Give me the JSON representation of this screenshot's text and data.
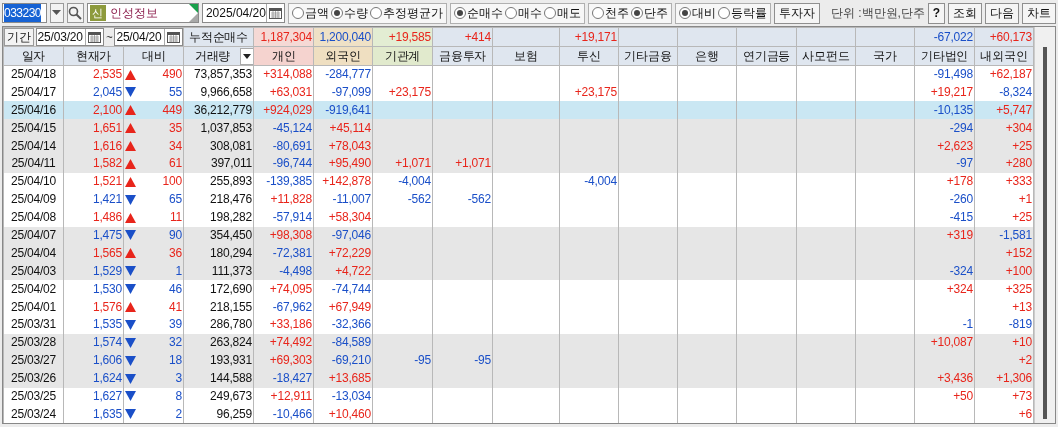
{
  "toolbar": {
    "stock_code": "033230",
    "market_badge": "신",
    "stock_name": "인성정보",
    "date": "2025/04/20",
    "radio_groups": [
      {
        "options": [
          {
            "label": "금액",
            "selected": false
          },
          {
            "label": "수량",
            "selected": true
          },
          {
            "label": "추정평균가",
            "selected": false
          }
        ]
      },
      {
        "options": [
          {
            "label": "순매수",
            "selected": true
          },
          {
            "label": "매수",
            "selected": false
          },
          {
            "label": "매도",
            "selected": false
          }
        ]
      },
      {
        "options": [
          {
            "label": "천주",
            "selected": false
          },
          {
            "label": "단주",
            "selected": true
          }
        ]
      },
      {
        "options": [
          {
            "label": "대비",
            "selected": true
          },
          {
            "label": "등락률",
            "selected": false
          }
        ]
      }
    ],
    "investor_button": "투자자",
    "unit_label": "단위 :백만원,단주",
    "buttons": [
      "?",
      "조회",
      "다음",
      "차트"
    ]
  },
  "period": {
    "label": "기간",
    "start": "25/03/20",
    "separator": "~",
    "end": "25/04/20"
  },
  "summary": {
    "label": "누적순매수",
    "values": {
      "individual": {
        "text": "1,187,304",
        "rising": true
      },
      "foreign": {
        "text": "1,200,040",
        "rising": false
      },
      "institutions": {
        "text": "+19,585",
        "rising": true
      },
      "financial_investment": {
        "text": "+414",
        "rising": true
      },
      "investment_trust": {
        "text": "+19,171",
        "rising": true
      },
      "other_corporations": {
        "text": "-67,022",
        "rising": false
      },
      "domestic_foreign": {
        "text": "+60,173",
        "rising": true
      }
    }
  },
  "table": {
    "columns": [
      {
        "label": "일자",
        "dropdown": false
      },
      {
        "label": "현재가",
        "dropdown": false
      },
      {
        "label": "대비",
        "dropdown": false
      },
      {
        "label": "거래량",
        "dropdown": true
      },
      {
        "label": "개인",
        "dropdown": false
      },
      {
        "label": "외국인",
        "dropdown": false
      },
      {
        "label": "기관계",
        "dropdown": false
      },
      {
        "label": "금융투자",
        "dropdown": false
      },
      {
        "label": "보험",
        "dropdown": false
      },
      {
        "label": "투신",
        "dropdown": false
      },
      {
        "label": "기타금융",
        "dropdown": false
      },
      {
        "label": "은행",
        "dropdown": false
      },
      {
        "label": "연기금등",
        "dropdown": false
      },
      {
        "label": "사모펀드",
        "dropdown": false
      },
      {
        "label": "국가",
        "dropdown": false
      },
      {
        "label": "기타법인",
        "dropdown": false
      },
      {
        "label": "내외국인",
        "dropdown": false
      }
    ],
    "rows": [
      {
        "date": "25/04/18",
        "price": "2,535",
        "rising": true,
        "change": "490",
        "volume": "73,857,353",
        "shaded": false,
        "selected": false,
        "individual": "+314,088",
        "foreign": "-284,777",
        "other_corporations": "-91,498",
        "domestic_foreign": "+62,187"
      },
      {
        "date": "25/04/17",
        "price": "2,045",
        "rising": false,
        "change": "55",
        "volume": "9,966,658",
        "shaded": false,
        "selected": false,
        "individual": "+63,031",
        "foreign": "-97,099",
        "institutions": "+23,175",
        "investment_trust": "+23,175",
        "other_corporations": "+19,217",
        "domestic_foreign": "-8,324"
      },
      {
        "date": "25/04/16",
        "price": "2,100",
        "rising": true,
        "change": "449",
        "volume": "36,212,779",
        "shaded": false,
        "selected": true,
        "individual": "+924,029",
        "foreign": "-919,641",
        "other_corporations": "-10,135",
        "domestic_foreign": "+5,747"
      },
      {
        "date": "25/04/15",
        "price": "1,651",
        "rising": true,
        "change": "35",
        "volume": "1,037,853",
        "shaded": true,
        "selected": false,
        "individual": "-45,124",
        "foreign": "+45,114",
        "other_corporations": "-294",
        "domestic_foreign": "+304"
      },
      {
        "date": "25/04/14",
        "price": "1,616",
        "rising": true,
        "change": "34",
        "volume": "308,081",
        "shaded": true,
        "selected": false,
        "individual": "-80,691",
        "foreign": "+78,043",
        "other_corporations": "+2,623",
        "domestic_foreign": "+25"
      },
      {
        "date": "25/04/11",
        "price": "1,582",
        "rising": true,
        "change": "61",
        "volume": "397,011",
        "shaded": true,
        "selected": false,
        "individual": "-96,744",
        "foreign": "+95,490",
        "institutions": "+1,071",
        "financial_investment": "+1,071",
        "other_corporations": "-97",
        "domestic_foreign": "+280"
      },
      {
        "date": "25/04/10",
        "price": "1,521",
        "rising": true,
        "change": "100",
        "volume": "255,893",
        "shaded": false,
        "selected": false,
        "individual": "-139,385",
        "foreign": "+142,878",
        "institutions": "-4,004",
        "investment_trust": "-4,004",
        "other_corporations": "+178",
        "domestic_foreign": "+333"
      },
      {
        "date": "25/04/09",
        "price": "1,421",
        "rising": false,
        "change": "65",
        "volume": "218,476",
        "shaded": false,
        "selected": false,
        "individual": "+11,828",
        "foreign": "-11,007",
        "institutions": "-562",
        "financial_investment": "-562",
        "other_corporations": "-260",
        "domestic_foreign": "+1"
      },
      {
        "date": "25/04/08",
        "price": "1,486",
        "rising": true,
        "change": "11",
        "volume": "198,282",
        "shaded": false,
        "selected": false,
        "individual": "-57,914",
        "foreign": "+58,304",
        "other_corporations": "-415",
        "domestic_foreign": "+25"
      },
      {
        "date": "25/04/07",
        "price": "1,475",
        "rising": false,
        "change": "90",
        "volume": "354,450",
        "shaded": true,
        "selected": false,
        "individual": "+98,308",
        "foreign": "-97,046",
        "other_corporations": "+319",
        "domestic_foreign": "-1,581"
      },
      {
        "date": "25/04/04",
        "price": "1,565",
        "rising": true,
        "change": "36",
        "volume": "180,294",
        "shaded": true,
        "selected": false,
        "individual": "-72,381",
        "foreign": "+72,229",
        "domestic_foreign": "+152"
      },
      {
        "date": "25/04/03",
        "price": "1,529",
        "rising": false,
        "change": "1",
        "volume": "111,373",
        "shaded": true,
        "selected": false,
        "individual": "-4,498",
        "foreign": "+4,722",
        "other_corporations": "-324",
        "domestic_foreign": "+100"
      },
      {
        "date": "25/04/02",
        "price": "1,530",
        "rising": false,
        "change": "46",
        "volume": "172,690",
        "shaded": false,
        "selected": false,
        "individual": "+74,095",
        "foreign": "-74,744",
        "other_corporations": "+324",
        "domestic_foreign": "+325"
      },
      {
        "date": "25/04/01",
        "price": "1,576",
        "rising": true,
        "change": "41",
        "volume": "218,155",
        "shaded": false,
        "selected": false,
        "individual": "-67,962",
        "foreign": "+67,949",
        "domestic_foreign": "+13"
      },
      {
        "date": "25/03/31",
        "price": "1,535",
        "rising": false,
        "change": "39",
        "volume": "286,780",
        "shaded": false,
        "selected": false,
        "individual": "+33,186",
        "foreign": "-32,366",
        "other_corporations": "-1",
        "domestic_foreign": "-819"
      },
      {
        "date": "25/03/28",
        "price": "1,574",
        "rising": false,
        "change": "32",
        "volume": "263,824",
        "shaded": true,
        "selected": false,
        "individual": "+74,492",
        "foreign": "-84,589",
        "other_corporations": "+10,087",
        "domestic_foreign": "+10"
      },
      {
        "date": "25/03/27",
        "price": "1,606",
        "rising": false,
        "change": "18",
        "volume": "193,931",
        "shaded": true,
        "selected": false,
        "individual": "+69,303",
        "foreign": "-69,210",
        "institutions": "-95",
        "financial_investment": "-95",
        "domestic_foreign": "+2"
      },
      {
        "date": "25/03/26",
        "price": "1,624",
        "rising": false,
        "change": "3",
        "volume": "144,588",
        "shaded": true,
        "selected": false,
        "individual": "-18,427",
        "foreign": "+13,685",
        "other_corporations": "+3,436",
        "domestic_foreign": "+1,306"
      },
      {
        "date": "25/03/25",
        "price": "1,627",
        "rising": false,
        "change": "8",
        "volume": "249,673",
        "shaded": false,
        "selected": false,
        "individual": "+12,911",
        "foreign": "-13,034",
        "other_corporations": "+50",
        "domestic_foreign": "+73"
      },
      {
        "date": "25/03/24",
        "price": "1,635",
        "rising": false,
        "change": "2",
        "volume": "96,259",
        "shaded": false,
        "selected": false,
        "individual": "-10,466",
        "foreign": "+10,460",
        "domestic_foreign": "+6"
      }
    ]
  }
}
